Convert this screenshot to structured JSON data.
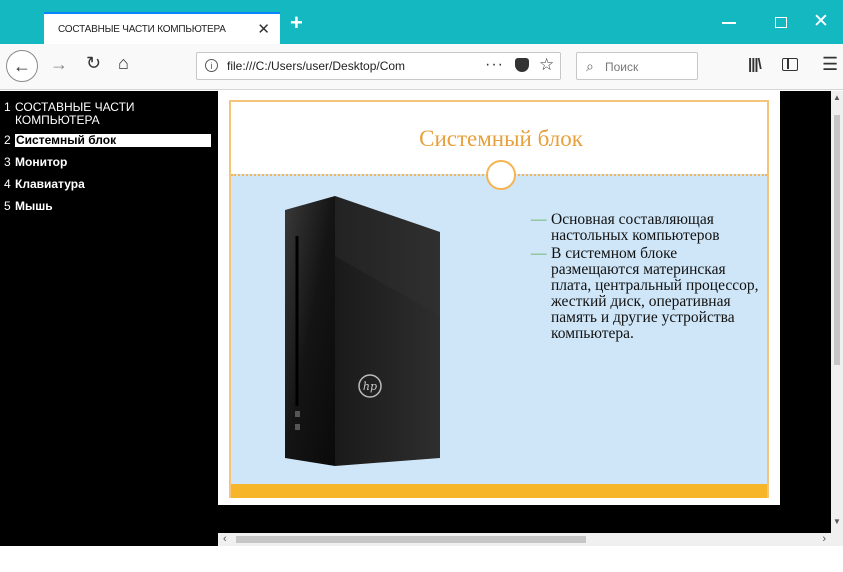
{
  "browser": {
    "tab_title": "СОСТАВНЫЕ ЧАСТИ КОМПЬЮТЕРА",
    "url": "file:///C:/Users/user/Desktop/Com",
    "search_placeholder": "Поиск",
    "accent_color": "#14b8c0"
  },
  "outline": {
    "items": [
      {
        "num": "1",
        "label": "СОСТАВНЫЕ ЧАСТИ КОМПЬЮТЕРА"
      },
      {
        "num": "2",
        "label": "Системный блок"
      },
      {
        "num": "3",
        "label": "Монитор"
      },
      {
        "num": "4",
        "label": "Клавиатура"
      },
      {
        "num": "5",
        "label": "Мышь"
      }
    ]
  },
  "slide": {
    "title": "Системный блок",
    "bullets": [
      "Основная составляющая настольных компьютеров",
      "В системном блоке размещаются материнская плата, центральный процессор, жесткий диск, оперативная память и другие устройства компьютера."
    ],
    "image": "hp-desktop-tower",
    "colors": {
      "title": "#e8a03c",
      "body": "#cfe6f8",
      "footer": "#f7b52a"
    }
  }
}
